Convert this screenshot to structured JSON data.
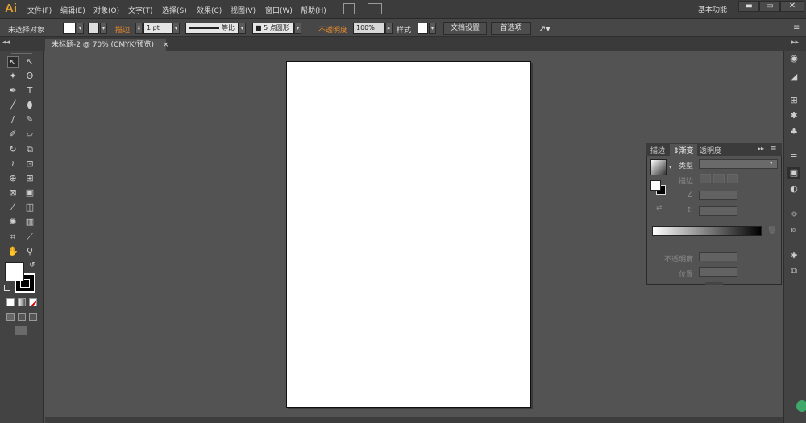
{
  "app": {
    "logo": "Ai"
  },
  "menu": [
    "文件(F)",
    "编辑(E)",
    "对象(O)",
    "文字(T)",
    "选择(S)",
    "效果(C)",
    "视图(V)",
    "窗口(W)",
    "帮助(H)"
  ],
  "workspace": {
    "label": "基本功能",
    "min": "▬",
    "max": "▭",
    "close": "✕"
  },
  "control": {
    "no_selection": "未选择对象",
    "stroke_label": "描边",
    "stroke_weight": "1 pt",
    "profile_label": "等比",
    "brush": "5 点圆形",
    "opacity_label": "不透明度",
    "opacity_value": "100%",
    "style_label": "样式",
    "doc_setup": "文档设置",
    "preferences": "首选项"
  },
  "tab": {
    "title": "未标题-2 @ 70% (CMYK/预览)",
    "close": "×"
  },
  "panel": {
    "tabs": [
      "描边",
      "渐变",
      "透明度"
    ],
    "type_label": "类型",
    "stroke_label": "描边",
    "opacity_label": "不透明度",
    "position_label": "位置"
  },
  "colors": {
    "accent_orange": "#e88a2c",
    "ui_dark": "#3c3c3c",
    "canvas_bg": "#535353"
  }
}
